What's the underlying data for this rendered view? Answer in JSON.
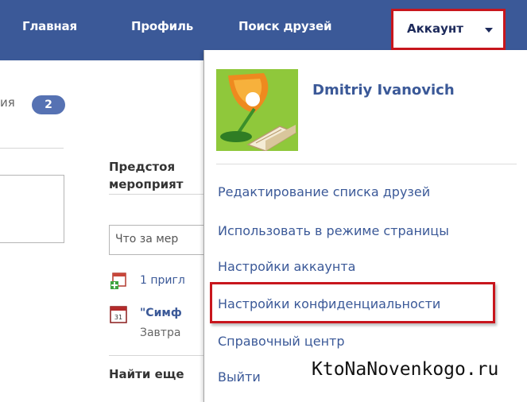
{
  "nav": {
    "home": "Главная",
    "profile": "Профиль",
    "find_friends": "Поиск друзей",
    "account": "Аккаунт"
  },
  "left": {
    "label_fragment": "ия",
    "badge_count": "2"
  },
  "events": {
    "heading": "Предстоя мероприят",
    "input_placeholder": "Что за мер",
    "invite_text": "1 пригл",
    "event_title": "\"Симф",
    "event_time": "Завтра",
    "calendar_day": "31",
    "find_more": "Найти еще"
  },
  "dropdown": {
    "user_name": "Dmitriy Ivanovich",
    "items": [
      {
        "label": "Редактирование списка друзей"
      },
      {
        "label": "Использовать в режиме страницы"
      },
      {
        "label": "Настройки аккаунта"
      },
      {
        "label": "Настройки конфиденциальности"
      },
      {
        "label": "Справочный центр"
      },
      {
        "label": "Выйти"
      }
    ]
  },
  "watermark": "KtoNaNovenkogo.ru",
  "colors": {
    "brand": "#3b5998",
    "highlight": "#c8161d",
    "avatar_bg": "#90c93c"
  }
}
